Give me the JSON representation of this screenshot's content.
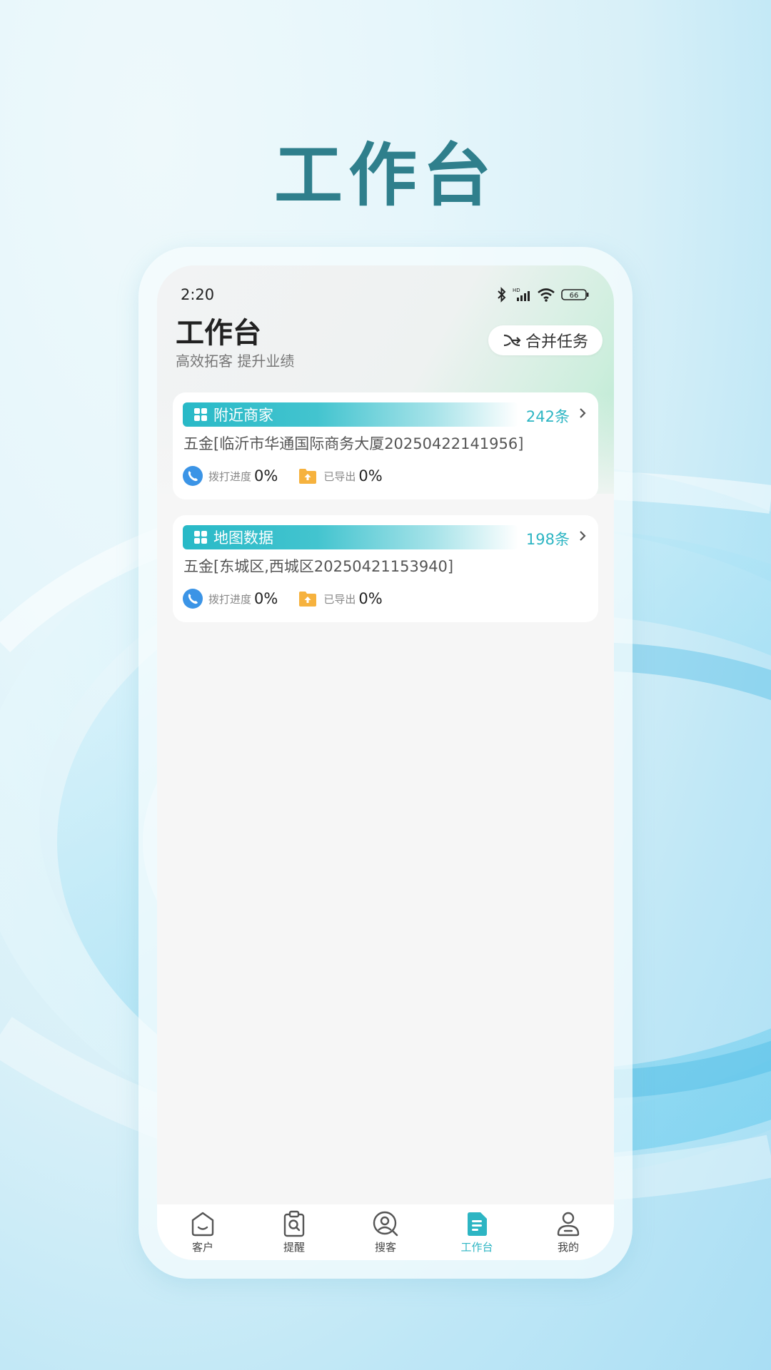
{
  "hero": {
    "title": "工作台"
  },
  "status_bar": {
    "time": "2:20",
    "battery": "66",
    "network_badge": "HD"
  },
  "header": {
    "title": "工作台",
    "subtitle": "高效拓客 提升业绩",
    "merge_button_label": "合并任务"
  },
  "tasks": [
    {
      "category": "附近商家",
      "count": "242条",
      "name": "五金[临沂市华通国际商务大厦20250422141956]",
      "call_progress_label": "拨打进度",
      "call_progress_value": "0%",
      "exported_label": "已导出",
      "exported_value": "0%"
    },
    {
      "category": "地图数据",
      "count": "198条",
      "name": "五金[东城区,西城区20250421153940]",
      "call_progress_label": "拨打进度",
      "call_progress_value": "0%",
      "exported_label": "已导出",
      "exported_value": "0%"
    }
  ],
  "tab_bar": {
    "active": "工作台",
    "tabs": [
      {
        "label": "客户",
        "icon": "customer-icon"
      },
      {
        "label": "提醒",
        "icon": "reminder-icon"
      },
      {
        "label": "搜客",
        "icon": "search-customer-icon"
      },
      {
        "label": "工作台",
        "icon": "workbench-icon"
      },
      {
        "label": "我的",
        "icon": "profile-icon"
      }
    ]
  },
  "colors": {
    "accent": "#2db5c3",
    "hero_title": "#2f7f8c",
    "call_icon": "#3b94e6",
    "export_icon": "#f6b23e"
  }
}
